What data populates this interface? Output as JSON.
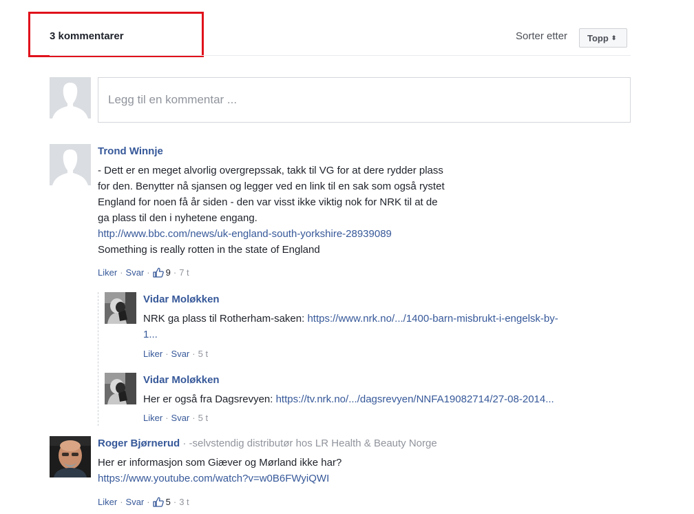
{
  "header": {
    "comment_count": "3 kommentarer",
    "sort_label": "Sorter etter",
    "sort_value": "Topp"
  },
  "composer": {
    "placeholder": "Legg til en kommentar ..."
  },
  "comments": [
    {
      "author": "Trond Winnje",
      "lines": [
        "- Dett er en meget alvorlig overgrepssak, takk til VG for at dere rydder plass",
        "for den. Benytter nå sjansen og legger ved en link til en sak som også rystet",
        "England for noen få år siden - den var visst ikke viktig nok for NRK til at de",
        "ga plass til den i nyhetene engang."
      ],
      "link": "http://www.bbc.com/news/uk-england-south-yorkshire-28939089",
      "tail": "Something is really rotten in the state of England",
      "like_label": "Liker",
      "reply_label": "Svar",
      "likes": "9",
      "time": "7 t",
      "replies": [
        {
          "author": "Vidar Moløkken",
          "text": "NRK ga plass til Rotherham-saken: ",
          "link_line1": "https://www.nrk.no/.../1400-barn-misbrukt-i-engelsk-by-",
          "link_line2": "1...",
          "like_label": "Liker",
          "reply_label": "Svar",
          "time": "5 t"
        },
        {
          "author": "Vidar Moløkken",
          "text": "Her er også fra Dagsrevyen: ",
          "link": "https://tv.nrk.no/.../dagsrevyen/NNFA19082714/27-08-2014...",
          "like_label": "Liker",
          "reply_label": "Svar",
          "time": "5 t"
        }
      ]
    },
    {
      "author": "Roger Bjørnerud",
      "subtitle": "-selvstendig distributør hos LR Health & Beauty Norge",
      "text": "Her er informasjon som Giæver og Mørland ikke har?",
      "link": "https://www.youtube.com/watch?v=w0B6FWyiQWI",
      "like_label": "Liker",
      "reply_label": "Svar",
      "likes": "5",
      "time": "3 t"
    }
  ],
  "colors": {
    "link": "#365899",
    "highlight": "#e0111b",
    "muted": "#90949c"
  }
}
